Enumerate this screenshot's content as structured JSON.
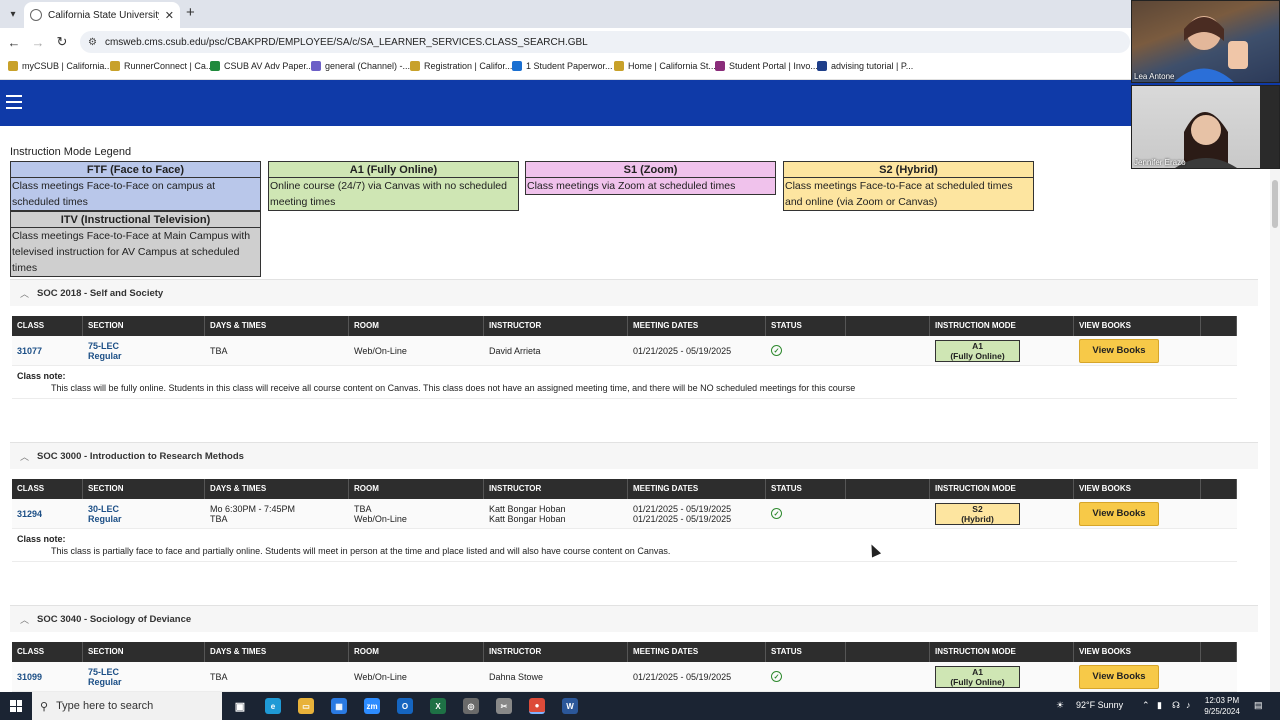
{
  "browser": {
    "tab_title": "California State University, Bak",
    "url": "cmsweb.cms.csub.edu/psc/CBAKPRD/EMPLOYEE/SA/c/SA_LEARNER_SERVICES.CLASS_SEARCH.GBL",
    "bookmarks": [
      "myCSUB | California...",
      "RunnerConnect | Ca...",
      "CSUB AV Adv Paper...",
      "general (Channel) -...",
      "Registration | Califor...",
      "1 Student Paperwor...",
      "Home | California St...",
      "Student Portal | Invo...",
      "advising tutorial | P..."
    ]
  },
  "legend": {
    "title": "Instruction Mode Legend",
    "items": [
      {
        "head": "FTF (Face to Face)",
        "body": "Class meetings Face-to-Face on campus at scheduled times",
        "color": "#b9c7ea"
      },
      {
        "head": "A1 (Fully Online)",
        "body": "Online course (24/7) via Canvas with no scheduled meeting times",
        "color": "#cfe6b4"
      },
      {
        "head": "S1 (Zoom)",
        "body": "Class meetings via Zoom at scheduled times",
        "color": "#f0c2ec"
      },
      {
        "head": "S2 (Hybrid)",
        "body": "Class meetings Face-to-Face at scheduled times and online (via Zoom or Canvas)",
        "color": "#fde5a0"
      },
      {
        "head": "ITV (Instructional Television)",
        "body": "Class meetings Face-to-Face at Main Campus with televised instruction for AV Campus at scheduled times",
        "color": "#cfcfcf"
      }
    ]
  },
  "columns": [
    "CLASS",
    "SECTION",
    "DAYS & TIMES",
    "ROOM",
    "INSTRUCTOR",
    "MEETING DATES",
    "STATUS",
    "",
    "INSTRUCTION MODE",
    "VIEW BOOKS"
  ],
  "courses": [
    {
      "title": "SOC 2018 - Self and Society",
      "class": "31077",
      "section1": "75-LEC",
      "section2": "Regular",
      "days1": "TBA",
      "days2": "",
      "room1": "Web/On-Line",
      "room2": "",
      "instr1": "David Arrieta",
      "instr2": "",
      "dates1": "01/21/2025 - 05/19/2025",
      "dates2": "",
      "mode1": "A1",
      "mode2": "(Fully Online)",
      "mode_color": "#cfe6b4",
      "books": "View Books",
      "note_label": "Class note:",
      "note": "This class will be fully online. Students in this class will receive all course content on Canvas. This class does not have an assigned meeting time, and there will be NO scheduled meetings for this course"
    },
    {
      "title": "SOC 3000 - Introduction to Research Methods",
      "class": "31294",
      "section1": "30-LEC",
      "section2": "Regular",
      "days1": "Mo 6:30PM - 7:45PM",
      "days2": "TBA",
      "room1": "TBA",
      "room2": "Web/On-Line",
      "instr1": "Katt Bongar Hoban",
      "instr2": "Katt Bongar Hoban",
      "dates1": "01/21/2025 - 05/19/2025",
      "dates2": "01/21/2025 - 05/19/2025",
      "mode1": "S2",
      "mode2": "(Hybrid)",
      "mode_color": "#fde5a0",
      "books": "View Books",
      "note_label": "Class note:",
      "note": "This class is partially face to face and partially online. Students will meet in person at the time and place listed and will also have course content on Canvas."
    },
    {
      "title": "SOC 3040 - Sociology of Deviance",
      "class": "31099",
      "section1": "75-LEC",
      "section2": "Regular",
      "days1": "TBA",
      "days2": "",
      "room1": "Web/On-Line",
      "room2": "",
      "instr1": "Dahna Stowe",
      "instr2": "",
      "dates1": "01/21/2025 - 05/19/2025",
      "dates2": "",
      "mode1": "A1",
      "mode2": "(Fully Online)",
      "mode_color": "#cfe6b4",
      "books": "View Books",
      "note_label": "",
      "note": ""
    }
  ],
  "video": {
    "person1": "Lea Antone",
    "person2": "Jennifer Erazo"
  },
  "taskbar": {
    "search_placeholder": "Type here to search",
    "weather": "92°F  Sunny",
    "time": "12:03 PM",
    "date": "9/25/2024"
  }
}
